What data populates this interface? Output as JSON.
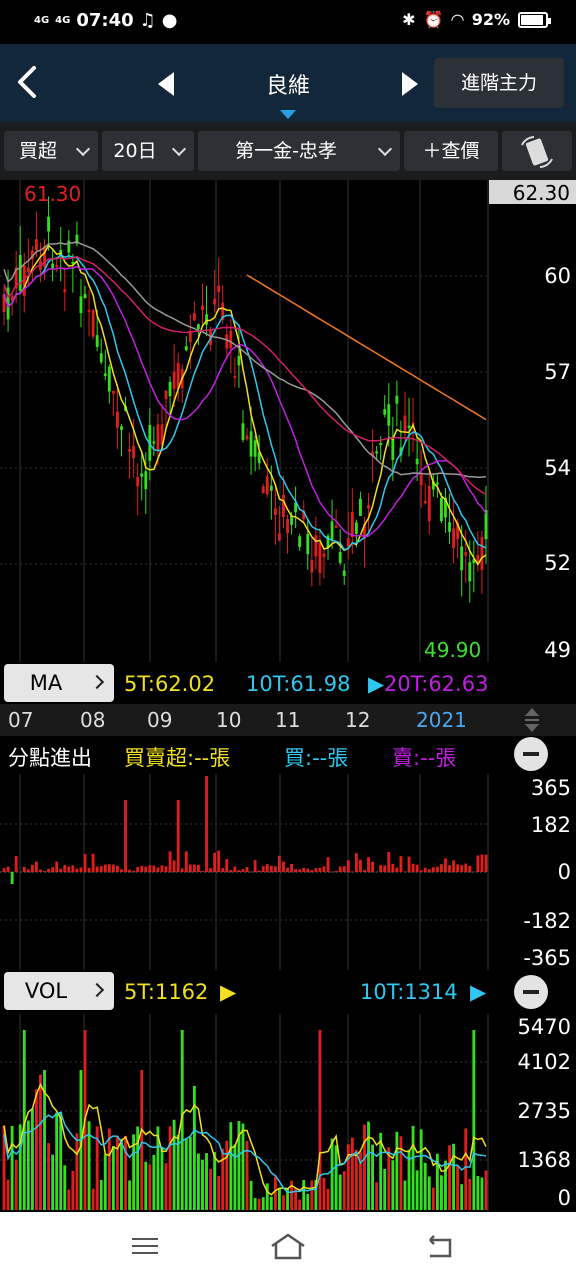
{
  "status_bar": {
    "net1": "4G",
    "net2": "4G",
    "time": "07:40",
    "battery": "92%",
    "battery_level": 0.92
  },
  "header": {
    "title": "良維",
    "advanced_button": "進階主力"
  },
  "toolbar": {
    "filter": "買超",
    "period": "20日",
    "broker": "第一金-忠孝",
    "query_button": "＋查價"
  },
  "price_chart": {
    "high_label": "61.30",
    "low_label": "49.90",
    "current_price": "62.30",
    "y_ticks": [
      "60",
      "57",
      "54",
      "52",
      "49"
    ],
    "colors": {
      "up": "#e01e1e",
      "down": "#33e020",
      "ma5": "#f0e020",
      "ma10": "#30c8f0",
      "ma20": "#c020e0",
      "ma60": "#9a9a9a",
      "ma120": "#d0206a",
      "ma240": "#f07820"
    }
  },
  "ma_bar": {
    "label": "MA",
    "ma5": "5T:62.02",
    "ma10": "10T:61.98",
    "ma20": "20T:62.63"
  },
  "month_axis": [
    "07",
    "08",
    "09",
    "10",
    "11",
    "12",
    "2021"
  ],
  "branch_panel": {
    "title": "分點進出",
    "net": "買賣超:--張",
    "buy": "買:--張",
    "sell": "賣:--張",
    "y_ticks": [
      "365",
      "182",
      "0",
      "-182",
      "-365"
    ]
  },
  "volume_panel": {
    "label": "VOL",
    "ma5": "5T:1162",
    "ma10": "10T:1314",
    "y_ticks": [
      "5470",
      "4102",
      "2735",
      "1368",
      "0"
    ]
  }
}
